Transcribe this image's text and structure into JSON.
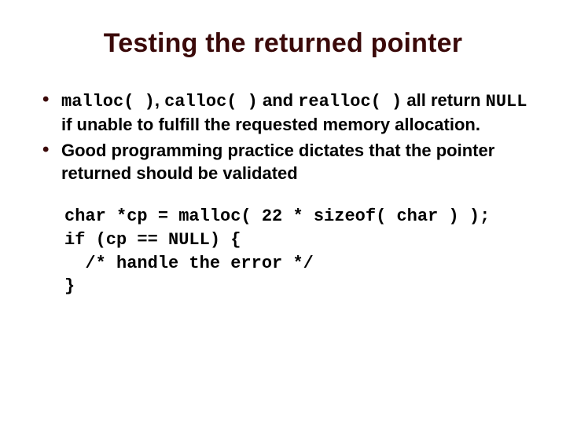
{
  "title": "Testing the returned pointer",
  "bullets": {
    "b1": {
      "code1": "malloc( )",
      "sep1": ", ",
      "code2": "calloc( )",
      "mid": " and ",
      "code3": "realloc( )",
      "tail1": " all return ",
      "code4": "NULL",
      "tail2": " if unable to fulfill the requested memory allocation."
    },
    "b2": {
      "text": "Good programming practice dictates that the pointer returned should be validated"
    }
  },
  "codeblock": "char *cp = malloc( 22 * sizeof( char ) );\nif (cp == NULL) {\n  /* handle the error */\n}"
}
